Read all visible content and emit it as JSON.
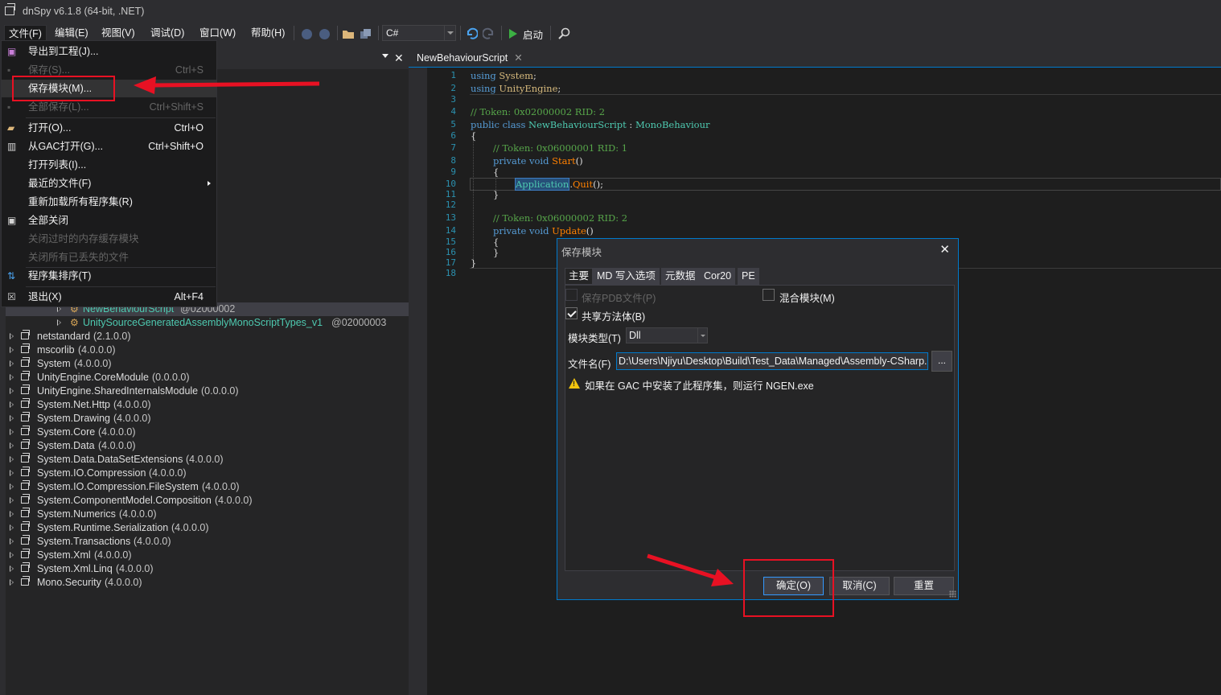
{
  "window": {
    "title": "dnSpy v6.1.8 (64-bit, .NET)"
  },
  "menubar": {
    "items": [
      "文件(F)",
      "编辑(E)",
      "视图(V)",
      "调试(D)",
      "窗口(W)",
      "帮助(H)"
    ]
  },
  "toolbar": {
    "language": "C#",
    "start_label": "启动"
  },
  "file_menu": {
    "items": [
      {
        "label": "导出到工程(J)...",
        "shortcut": "",
        "enabled": true,
        "icon": "export-icon"
      },
      {
        "label": "保存(S)...",
        "shortcut": "Ctrl+S",
        "enabled": false,
        "icon": "save-icon"
      },
      {
        "label": "保存模块(M)...",
        "shortcut": "",
        "enabled": true,
        "icon": ""
      },
      {
        "label": "全部保存(L)...",
        "shortcut": "Ctrl+Shift+S",
        "enabled": false,
        "icon": "save-all-icon"
      },
      {
        "label": "打开(O)...",
        "shortcut": "Ctrl+O",
        "enabled": true,
        "icon": "open-folder-icon"
      },
      {
        "label": "从GAC打开(G)...",
        "shortcut": "Ctrl+Shift+O",
        "enabled": true,
        "icon": "gac-icon"
      },
      {
        "label": "打开列表(I)...",
        "shortcut": "",
        "enabled": true,
        "icon": ""
      },
      {
        "label": "最近的文件(F)",
        "shortcut": "",
        "enabled": true,
        "icon": "",
        "submenu": true
      },
      {
        "label": "重新加载所有程序集(R)",
        "shortcut": "",
        "enabled": true,
        "icon": ""
      },
      {
        "label": "全部关闭",
        "shortcut": "",
        "enabled": true,
        "icon": "close-all-icon"
      },
      {
        "label": "关闭过时的内存缓存模块",
        "shortcut": "",
        "enabled": false,
        "icon": ""
      },
      {
        "label": "关闭所有已丢失的文件",
        "shortcut": "",
        "enabled": false,
        "icon": ""
      },
      {
        "label": "程序集排序(T)",
        "shortcut": "",
        "enabled": true,
        "icon": "sort-icon"
      },
      {
        "label": "退出(X)",
        "shortcut": "Alt+F4",
        "enabled": true,
        "icon": "exit-icon"
      }
    ]
  },
  "tree": {
    "types": [
      {
        "name": "NewBehaviourScript",
        "token": "@02000002"
      },
      {
        "name": "UnitySourceGeneratedAssemblyMonoScriptTypes_v1",
        "token": "@02000003"
      }
    ],
    "assemblies": [
      {
        "name": "netstandard",
        "version": "(2.1.0.0)"
      },
      {
        "name": "mscorlib",
        "version": "(4.0.0.0)"
      },
      {
        "name": "System",
        "version": "(4.0.0.0)"
      },
      {
        "name": "UnityEngine.CoreModule",
        "version": "(0.0.0.0)"
      },
      {
        "name": "UnityEngine.SharedInternalsModule",
        "version": "(0.0.0.0)"
      },
      {
        "name": "System.Net.Http",
        "version": "(4.0.0.0)"
      },
      {
        "name": "System.Drawing",
        "version": "(4.0.0.0)"
      },
      {
        "name": "System.Core",
        "version": "(4.0.0.0)"
      },
      {
        "name": "System.Data",
        "version": "(4.0.0.0)"
      },
      {
        "name": "System.Data.DataSetExtensions",
        "version": "(4.0.0.0)"
      },
      {
        "name": "System.IO.Compression",
        "version": "(4.0.0.0)"
      },
      {
        "name": "System.IO.Compression.FileSystem",
        "version": "(4.0.0.0)"
      },
      {
        "name": "System.ComponentModel.Composition",
        "version": "(4.0.0.0)"
      },
      {
        "name": "System.Numerics",
        "version": "(4.0.0.0)"
      },
      {
        "name": "System.Runtime.Serialization",
        "version": "(4.0.0.0)"
      },
      {
        "name": "System.Transactions",
        "version": "(4.0.0.0)"
      },
      {
        "name": "System.Xml",
        "version": "(4.0.0.0)"
      },
      {
        "name": "System.Xml.Linq",
        "version": "(4.0.0.0)"
      },
      {
        "name": "Mono.Security",
        "version": "(4.0.0.0)"
      }
    ]
  },
  "editor": {
    "tab_title": "NewBehaviourScript",
    "line_numbers": [
      "1",
      "2",
      "3",
      "4",
      "5",
      "6",
      "7",
      "8",
      "9",
      "10",
      "11",
      "12",
      "13",
      "14",
      "15",
      "16",
      "17",
      "18"
    ],
    "code": {
      "l1_kw": "using",
      "l1_ns": "System",
      "l1_end": ";",
      "l2_kw": "using",
      "l2_ns": "UnityEngine",
      "l2_end": ";",
      "l4": "// Token: 0x02000002 RID: 2",
      "l5_kw": "public class",
      "l5_cls": "NewBehaviourScript",
      "l5_colon": " : ",
      "l5_base": "MonoBehaviour",
      "l6": "{",
      "l7": "// Token: 0x06000001 RID: 1",
      "l8_kw": "private void",
      "l8_me": "Start",
      "l8_end": "()",
      "l9": "{",
      "l10_ty": "Application",
      "l10_dot": ".",
      "l10_me": "Quit",
      "l10_end": "();",
      "l11": "}",
      "l13": "// Token: 0x06000002 RID: 2",
      "l14_kw": "private void",
      "l14_me": "Update",
      "l14_end": "()",
      "l15": "{",
      "l16": "}",
      "l17": "}"
    }
  },
  "dialog": {
    "title": "保存模块",
    "tabs": [
      "主要",
      "MD 写入选项",
      "元数据",
      "Cor20",
      "PE"
    ],
    "save_pdb_label": "保存PDB文件(P)",
    "mixed_mode_label": "混合模块(M)",
    "share_method_label": "共享方法体(B)",
    "module_type_label": "模块类型(T)",
    "module_type_value": "Dll",
    "filename_label": "文件名(F)",
    "filename_value": "D:\\Users\\Njiyu\\Desktop\\Build\\Test_Data\\Managed\\Assembly-CSharp.dll",
    "browse_label": "...",
    "warning_text": "如果在 GAC 中安装了此程序集，则运行 NGEN.exe",
    "ok_label": "确定(O)",
    "cancel_label": "取消(C)",
    "reset_label": "重置"
  },
  "colors": {
    "accent": "#007acc",
    "annotation_red": "#e81123",
    "background": "#2d2d30"
  }
}
